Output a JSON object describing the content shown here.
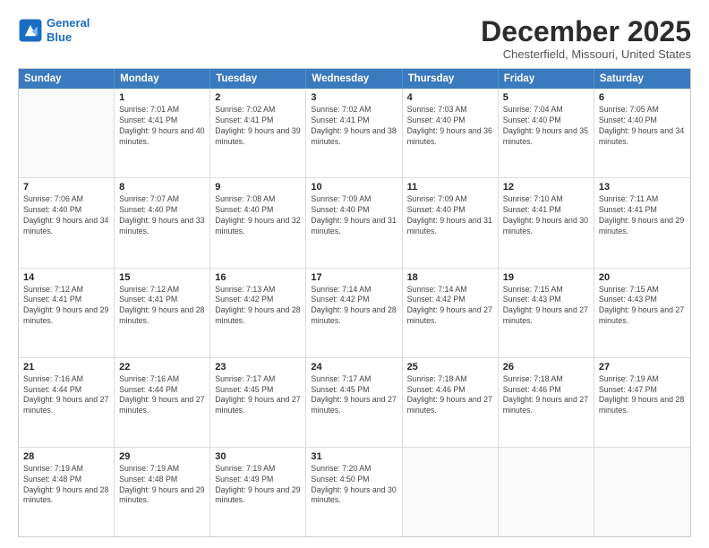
{
  "logo": {
    "line1": "General",
    "line2": "Blue"
  },
  "title": "December 2025",
  "location": "Chesterfield, Missouri, United States",
  "header_days": [
    "Sunday",
    "Monday",
    "Tuesday",
    "Wednesday",
    "Thursday",
    "Friday",
    "Saturday"
  ],
  "weeks": [
    [
      {
        "day": "",
        "sunrise": "",
        "sunset": "",
        "daylight": "",
        "empty": true
      },
      {
        "day": "1",
        "sunrise": "Sunrise: 7:01 AM",
        "sunset": "Sunset: 4:41 PM",
        "daylight": "Daylight: 9 hours and 40 minutes."
      },
      {
        "day": "2",
        "sunrise": "Sunrise: 7:02 AM",
        "sunset": "Sunset: 4:41 PM",
        "daylight": "Daylight: 9 hours and 39 minutes."
      },
      {
        "day": "3",
        "sunrise": "Sunrise: 7:02 AM",
        "sunset": "Sunset: 4:41 PM",
        "daylight": "Daylight: 9 hours and 38 minutes."
      },
      {
        "day": "4",
        "sunrise": "Sunrise: 7:03 AM",
        "sunset": "Sunset: 4:40 PM",
        "daylight": "Daylight: 9 hours and 36 minutes."
      },
      {
        "day": "5",
        "sunrise": "Sunrise: 7:04 AM",
        "sunset": "Sunset: 4:40 PM",
        "daylight": "Daylight: 9 hours and 35 minutes."
      },
      {
        "day": "6",
        "sunrise": "Sunrise: 7:05 AM",
        "sunset": "Sunset: 4:40 PM",
        "daylight": "Daylight: 9 hours and 34 minutes."
      }
    ],
    [
      {
        "day": "7",
        "sunrise": "Sunrise: 7:06 AM",
        "sunset": "Sunset: 4:40 PM",
        "daylight": "Daylight: 9 hours and 34 minutes."
      },
      {
        "day": "8",
        "sunrise": "Sunrise: 7:07 AM",
        "sunset": "Sunset: 4:40 PM",
        "daylight": "Daylight: 9 hours and 33 minutes."
      },
      {
        "day": "9",
        "sunrise": "Sunrise: 7:08 AM",
        "sunset": "Sunset: 4:40 PM",
        "daylight": "Daylight: 9 hours and 32 minutes."
      },
      {
        "day": "10",
        "sunrise": "Sunrise: 7:09 AM",
        "sunset": "Sunset: 4:40 PM",
        "daylight": "Daylight: 9 hours and 31 minutes."
      },
      {
        "day": "11",
        "sunrise": "Sunrise: 7:09 AM",
        "sunset": "Sunset: 4:40 PM",
        "daylight": "Daylight: 9 hours and 31 minutes."
      },
      {
        "day": "12",
        "sunrise": "Sunrise: 7:10 AM",
        "sunset": "Sunset: 4:41 PM",
        "daylight": "Daylight: 9 hours and 30 minutes."
      },
      {
        "day": "13",
        "sunrise": "Sunrise: 7:11 AM",
        "sunset": "Sunset: 4:41 PM",
        "daylight": "Daylight: 9 hours and 29 minutes."
      }
    ],
    [
      {
        "day": "14",
        "sunrise": "Sunrise: 7:12 AM",
        "sunset": "Sunset: 4:41 PM",
        "daylight": "Daylight: 9 hours and 29 minutes."
      },
      {
        "day": "15",
        "sunrise": "Sunrise: 7:12 AM",
        "sunset": "Sunset: 4:41 PM",
        "daylight": "Daylight: 9 hours and 28 minutes."
      },
      {
        "day": "16",
        "sunrise": "Sunrise: 7:13 AM",
        "sunset": "Sunset: 4:42 PM",
        "daylight": "Daylight: 9 hours and 28 minutes."
      },
      {
        "day": "17",
        "sunrise": "Sunrise: 7:14 AM",
        "sunset": "Sunset: 4:42 PM",
        "daylight": "Daylight: 9 hours and 28 minutes."
      },
      {
        "day": "18",
        "sunrise": "Sunrise: 7:14 AM",
        "sunset": "Sunset: 4:42 PM",
        "daylight": "Daylight: 9 hours and 27 minutes."
      },
      {
        "day": "19",
        "sunrise": "Sunrise: 7:15 AM",
        "sunset": "Sunset: 4:43 PM",
        "daylight": "Daylight: 9 hours and 27 minutes."
      },
      {
        "day": "20",
        "sunrise": "Sunrise: 7:15 AM",
        "sunset": "Sunset: 4:43 PM",
        "daylight": "Daylight: 9 hours and 27 minutes."
      }
    ],
    [
      {
        "day": "21",
        "sunrise": "Sunrise: 7:16 AM",
        "sunset": "Sunset: 4:44 PM",
        "daylight": "Daylight: 9 hours and 27 minutes."
      },
      {
        "day": "22",
        "sunrise": "Sunrise: 7:16 AM",
        "sunset": "Sunset: 4:44 PM",
        "daylight": "Daylight: 9 hours and 27 minutes."
      },
      {
        "day": "23",
        "sunrise": "Sunrise: 7:17 AM",
        "sunset": "Sunset: 4:45 PM",
        "daylight": "Daylight: 9 hours and 27 minutes."
      },
      {
        "day": "24",
        "sunrise": "Sunrise: 7:17 AM",
        "sunset": "Sunset: 4:45 PM",
        "daylight": "Daylight: 9 hours and 27 minutes."
      },
      {
        "day": "25",
        "sunrise": "Sunrise: 7:18 AM",
        "sunset": "Sunset: 4:46 PM",
        "daylight": "Daylight: 9 hours and 27 minutes."
      },
      {
        "day": "26",
        "sunrise": "Sunrise: 7:18 AM",
        "sunset": "Sunset: 4:46 PM",
        "daylight": "Daylight: 9 hours and 27 minutes."
      },
      {
        "day": "27",
        "sunrise": "Sunrise: 7:19 AM",
        "sunset": "Sunset: 4:47 PM",
        "daylight": "Daylight: 9 hours and 28 minutes."
      }
    ],
    [
      {
        "day": "28",
        "sunrise": "Sunrise: 7:19 AM",
        "sunset": "Sunset: 4:48 PM",
        "daylight": "Daylight: 9 hours and 28 minutes."
      },
      {
        "day": "29",
        "sunrise": "Sunrise: 7:19 AM",
        "sunset": "Sunset: 4:48 PM",
        "daylight": "Daylight: 9 hours and 29 minutes."
      },
      {
        "day": "30",
        "sunrise": "Sunrise: 7:19 AM",
        "sunset": "Sunset: 4:49 PM",
        "daylight": "Daylight: 9 hours and 29 minutes."
      },
      {
        "day": "31",
        "sunrise": "Sunrise: 7:20 AM",
        "sunset": "Sunset: 4:50 PM",
        "daylight": "Daylight: 9 hours and 30 minutes."
      },
      {
        "day": "",
        "sunrise": "",
        "sunset": "",
        "daylight": "",
        "empty": true
      },
      {
        "day": "",
        "sunrise": "",
        "sunset": "",
        "daylight": "",
        "empty": true
      },
      {
        "day": "",
        "sunrise": "",
        "sunset": "",
        "daylight": "",
        "empty": true
      }
    ]
  ]
}
